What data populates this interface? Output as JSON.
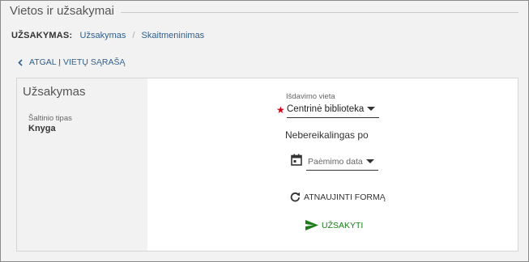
{
  "page_title": "Vietos ir užsakymai",
  "breadcrumb": {
    "label": "UŽSAKYMAS:",
    "items": [
      "Užsakymas",
      "Skaitmeninimas"
    ]
  },
  "back_link": "ATGAL Į VIETŲ SĄRAŠĄ",
  "sidebar": {
    "title": "Užsakymas",
    "source_type_label": "Šaltinio tipas",
    "source_type_value": "Knyga"
  },
  "form": {
    "pickup_label": "Išdavimo vieta",
    "pickup_value": "Centrinė biblioteka",
    "required_mark": "★",
    "not_needed_after": "Nebereikalingas po",
    "date_placeholder": "Paėmimo data",
    "refresh_label": "ATNAUJINTI FORMĄ",
    "submit_label": "UŽSAKYTI"
  },
  "colors": {
    "link": "#2f5f8f",
    "required": "#d0021b",
    "submit": "#1a7d1a"
  },
  "icons": [
    "chevron-left-icon",
    "calendar-icon",
    "refresh-icon",
    "send-icon",
    "caret-down-icon"
  ]
}
